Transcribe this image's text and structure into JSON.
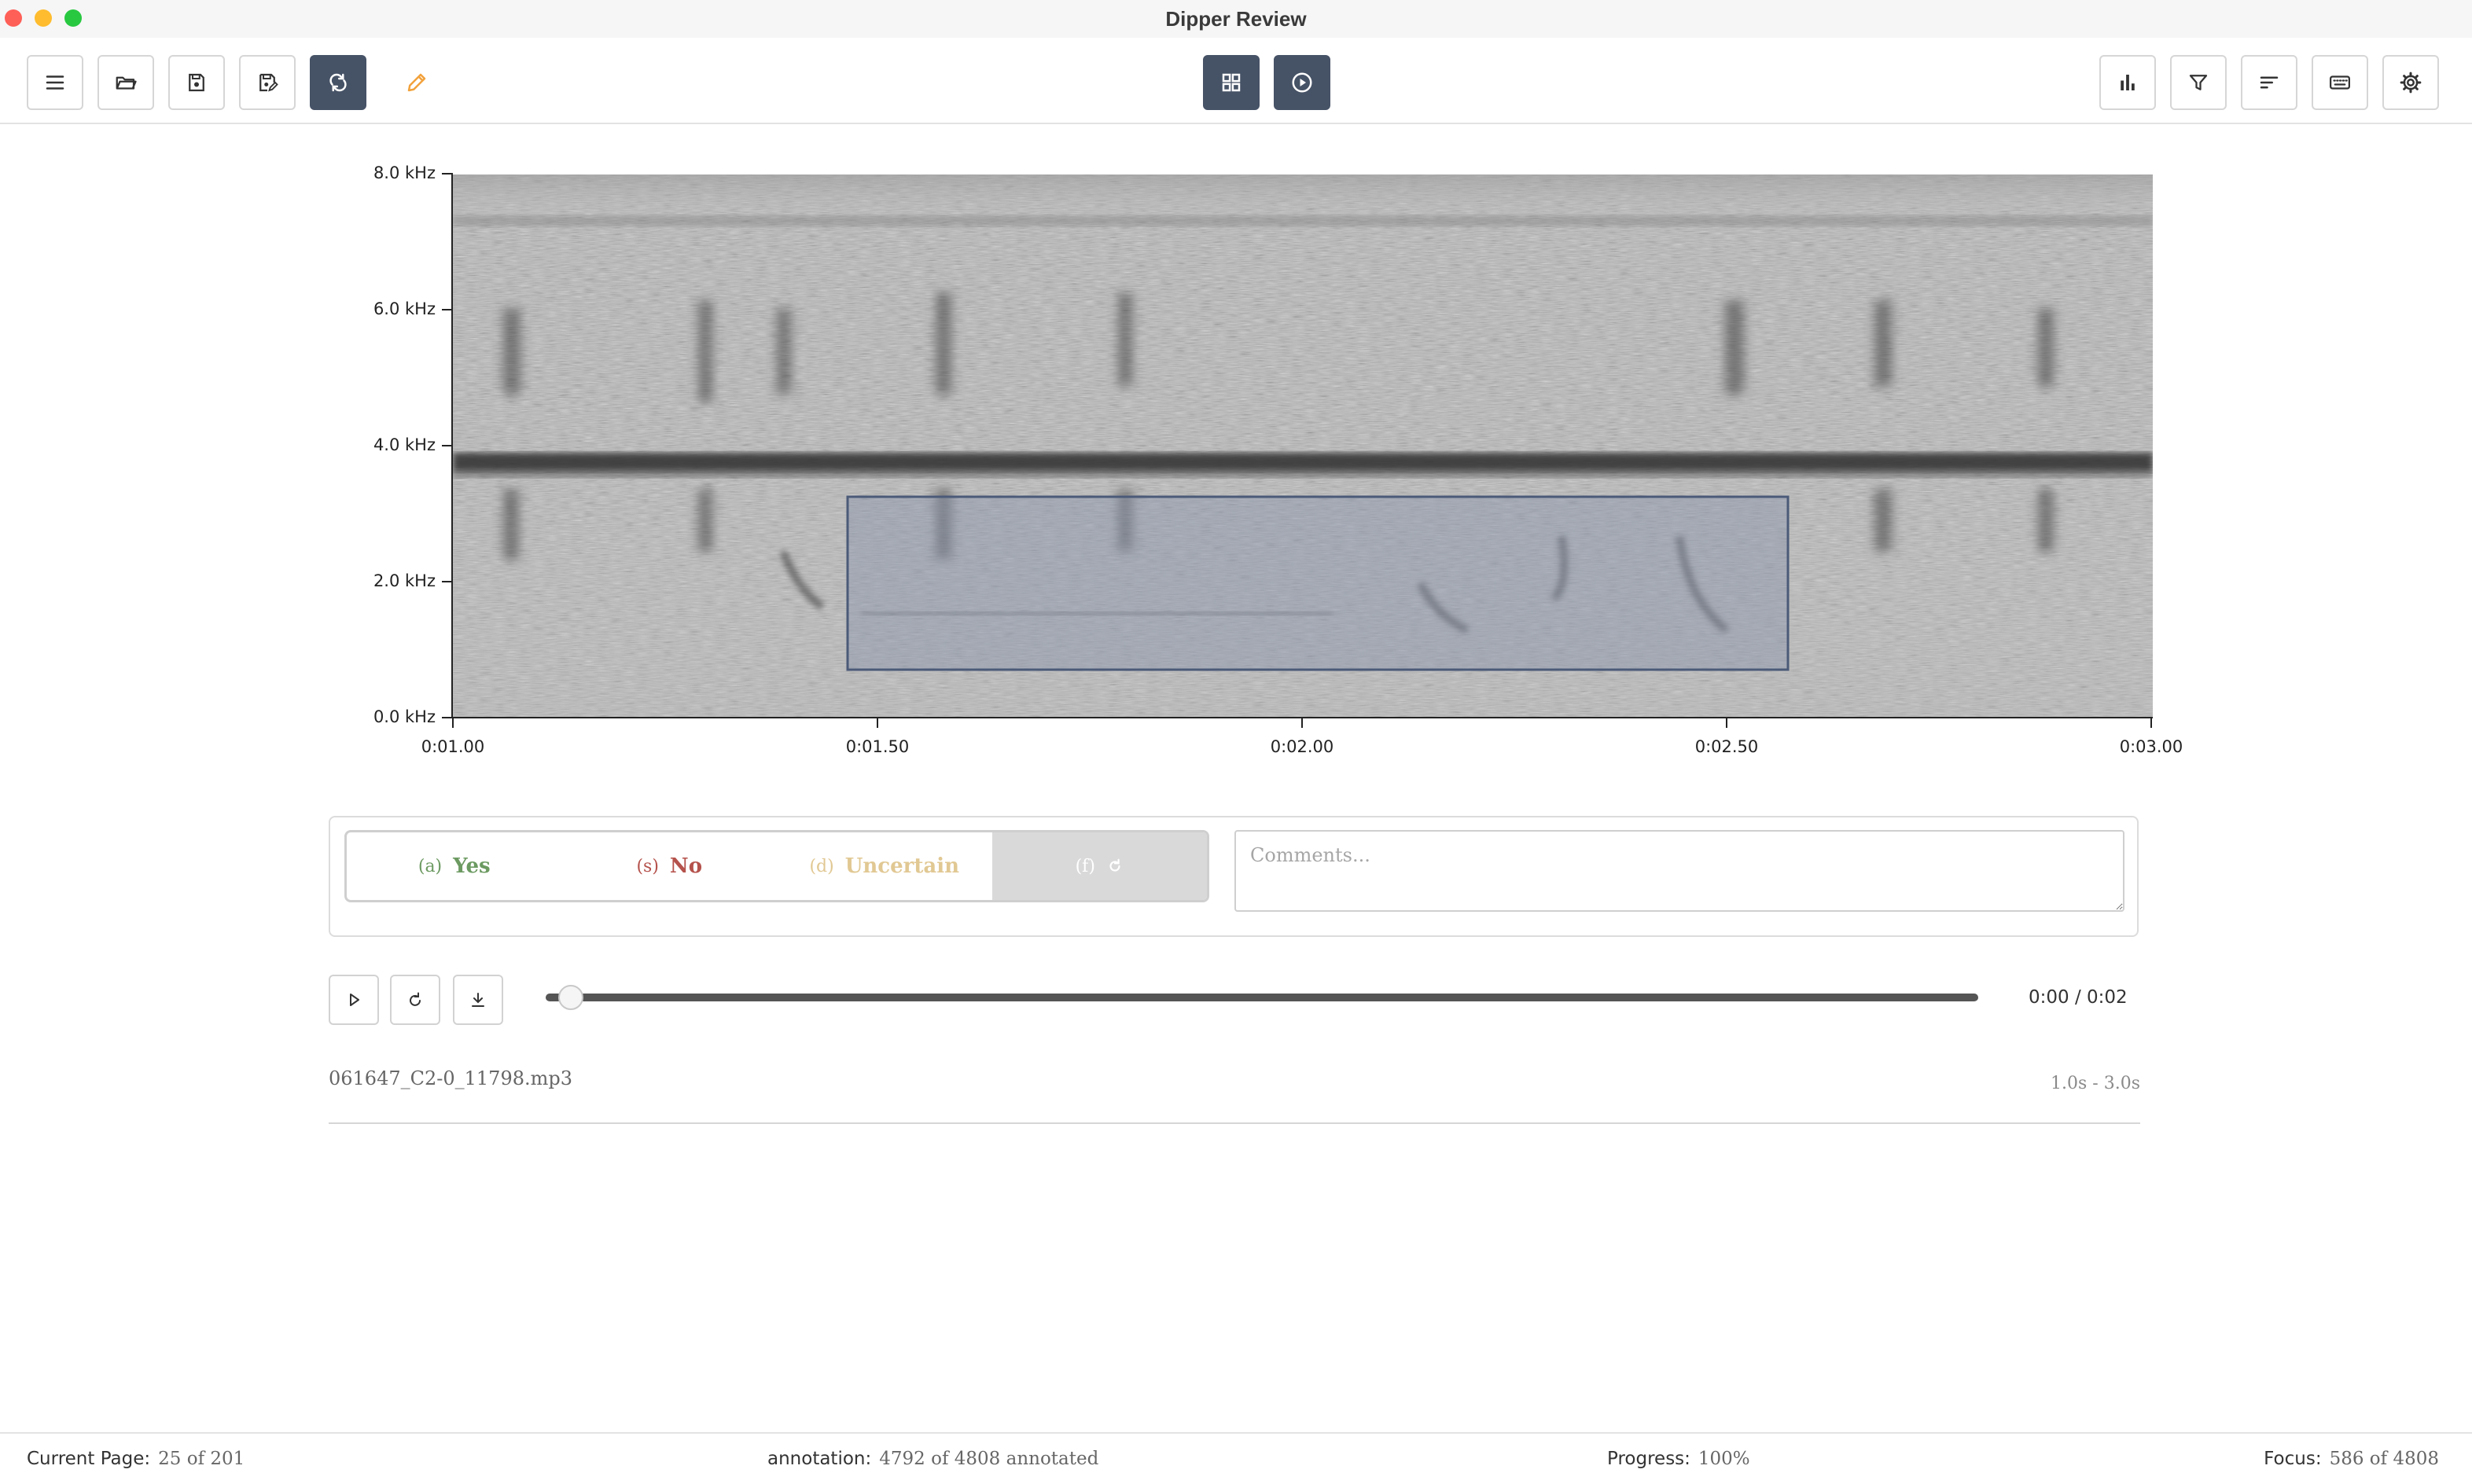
{
  "window": {
    "title": "Dipper Review"
  },
  "toolbar": {
    "left": [
      {
        "icon": "menu-icon"
      },
      {
        "icon": "folder-open-icon"
      },
      {
        "icon": "save-icon"
      },
      {
        "icon": "save-as-icon"
      },
      {
        "icon": "refresh-icon",
        "active": true
      },
      {
        "icon": "pencil-icon"
      }
    ],
    "center": [
      {
        "icon": "grid-view-icon",
        "active": true
      },
      {
        "icon": "play-circle-icon",
        "active": true
      }
    ],
    "right": [
      {
        "icon": "bar-chart-icon"
      },
      {
        "icon": "filter-icon"
      },
      {
        "icon": "sort-icon"
      },
      {
        "icon": "keyboard-icon"
      },
      {
        "icon": "settings-gear-icon"
      }
    ],
    "accent_color": "#465266",
    "pencil_color": "#f2a23c"
  },
  "spectrogram": {
    "y_labels": [
      "8.0 kHz",
      "6.0 kHz",
      "4.0 kHz",
      "2.0 kHz",
      "0.0 kHz"
    ],
    "x_labels": [
      "0:01.00",
      "0:01.50",
      "0:02.00",
      "0:02.50",
      "0:03.00"
    ],
    "selection": {
      "t_start": 1.465,
      "t_end": 2.575,
      "f_low": 0.7,
      "f_high": 3.25
    }
  },
  "annotation": {
    "choices": [
      {
        "key": "(a)",
        "label": "Yes"
      },
      {
        "key": "(s)",
        "label": "No"
      },
      {
        "key": "(d)",
        "label": "Uncertain"
      },
      {
        "key": "(f)",
        "icon": "reset-icon"
      }
    ],
    "comments_placeholder": "Comments..."
  },
  "player": {
    "time": "0:00 / 0:02",
    "progress": 0.0
  },
  "clip": {
    "filename": "061647_C2-0_11798.mp3",
    "range": "1.0s - 3.0s"
  },
  "status": {
    "page_label": "Current Page:",
    "page_value": "25 of 201",
    "annotation_label": "annotation:",
    "annotation_value": "4792 of 4808 annotated",
    "progress_label": "Progress:",
    "progress_value": "100%",
    "focus_label": "Focus:",
    "focus_value": "586 of 4808"
  }
}
